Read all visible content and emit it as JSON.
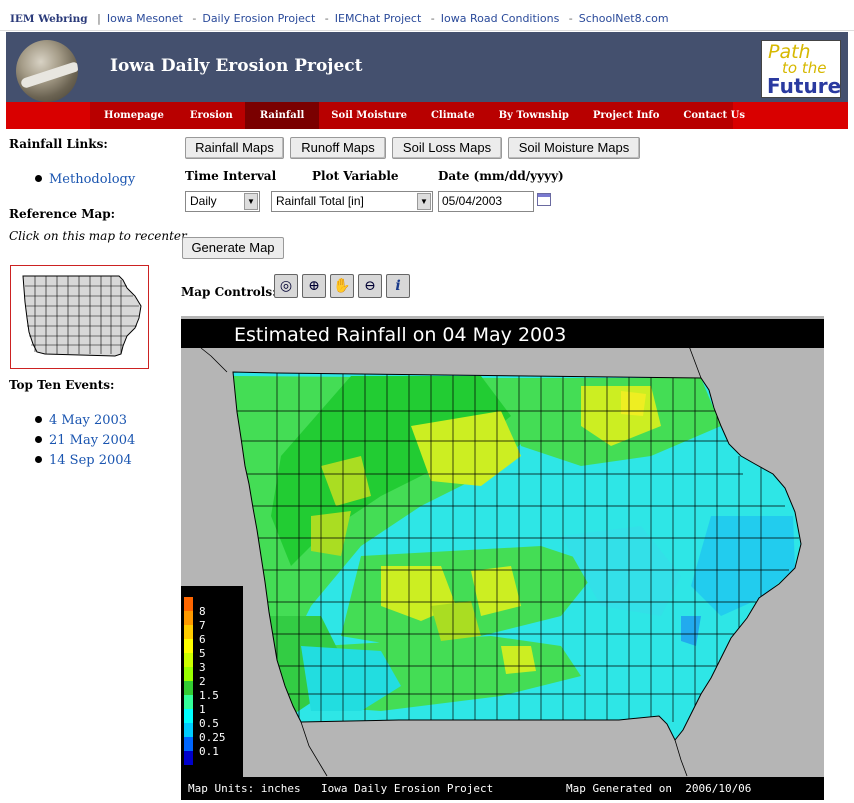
{
  "webring": {
    "title": "IEM Webring",
    "links": [
      "Iowa Mesonet",
      "Daily Erosion Project",
      "IEMChat Project",
      "Iowa Road Conditions",
      "SchoolNet8.com"
    ]
  },
  "header": {
    "site_title": "Iowa Daily Erosion Project",
    "logo_lines": [
      "Path",
      "to the",
      "Future"
    ]
  },
  "nav": {
    "items": [
      "Homepage",
      "Erosion",
      "Rainfall",
      "Soil Moisture",
      "Climate",
      "By Township",
      "Project Info",
      "Contact Us"
    ],
    "active": "Rainfall"
  },
  "sidebar": {
    "rainfall_links_heading": "Rainfall Links:",
    "rainfall_links": [
      "Methodology"
    ],
    "reference_heading": "Reference Map:",
    "reference_hint": "Click on this map to recenter.",
    "top_events_heading": "Top Ten Events:",
    "top_events": [
      "4 May 2003",
      "21 May 2004",
      "14 Sep 2004"
    ]
  },
  "map_tabs": [
    "Rainfall Maps",
    "Runoff Maps",
    "Soil Loss Maps",
    "Soil Moisture Maps"
  ],
  "form": {
    "time_interval_label": "Time Interval",
    "time_interval_value": "Daily",
    "plot_variable_label": "Plot Variable",
    "plot_variable_value": "Rainfall Total [in]",
    "date_label": "Date (mm/dd/yyyy)",
    "date_value": "05/04/2003",
    "generate_label": "Generate Map"
  },
  "map_controls": {
    "label": "Map Controls:",
    "tools": [
      "zoom-extent-icon",
      "zoom-in-icon",
      "pan-hand-icon",
      "zoom-out-icon",
      "info-icon"
    ]
  },
  "map": {
    "title": "Estimated Rainfall on 04 May 2003",
    "footer_units": "Map Units: inches",
    "footer_project": "Iowa Daily Erosion Project",
    "footer_generated": "Map Generated on  2006/10/06",
    "legend": [
      {
        "label": "8",
        "color": "#ff6600"
      },
      {
        "label": "7",
        "color": "#ff9900"
      },
      {
        "label": "6",
        "color": "#ffcc00"
      },
      {
        "label": "5",
        "color": "#ffff00"
      },
      {
        "label": "3",
        "color": "#ccff00"
      },
      {
        "label": "2",
        "color": "#99ff00"
      },
      {
        "label": "1.5",
        "color": "#33cc33"
      },
      {
        "label": "1",
        "color": "#33ff99"
      },
      {
        "label": "0.5",
        "color": "#00ffff"
      },
      {
        "label": "0.25",
        "color": "#00ccff"
      },
      {
        "label": "0.1",
        "color": "#0066ff"
      },
      {
        "label": "",
        "color": "#0000cc"
      }
    ]
  }
}
